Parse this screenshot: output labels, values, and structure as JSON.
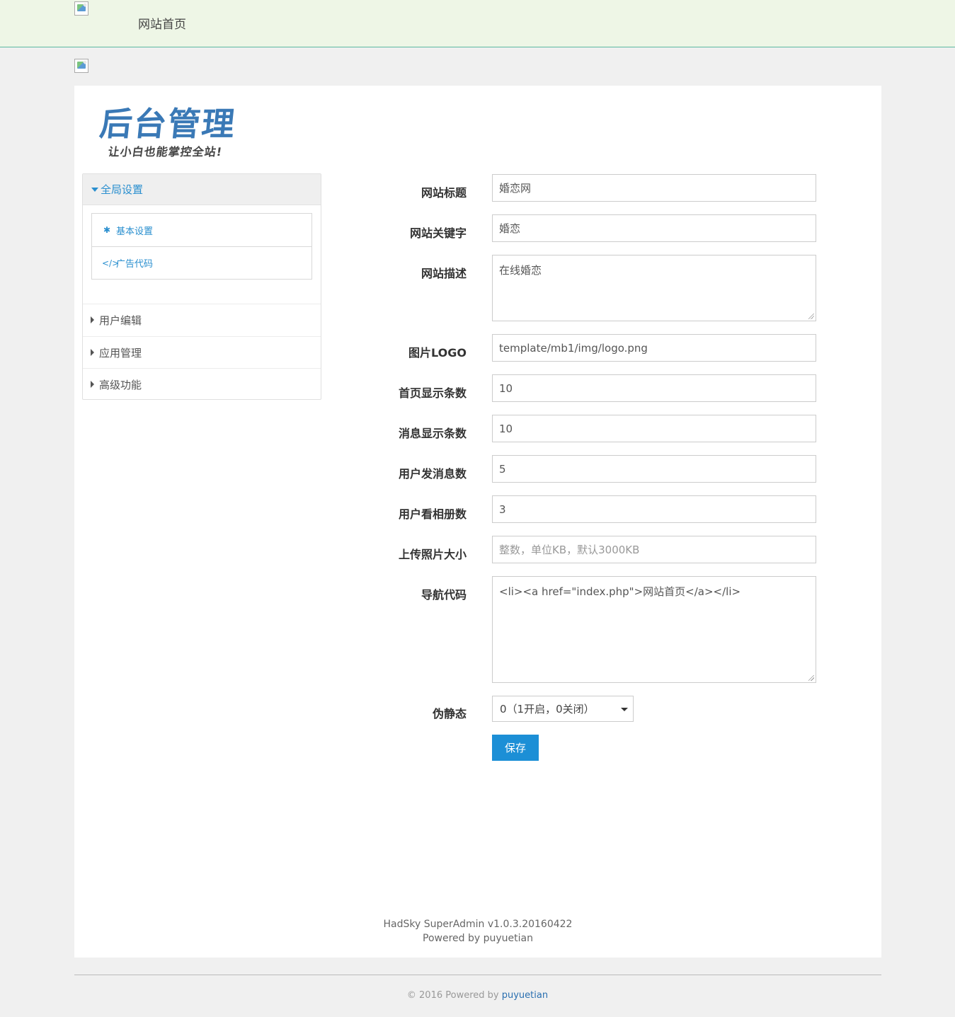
{
  "header": {
    "nav_home": "网站首页"
  },
  "brand": {
    "title": "后台管理",
    "subtitle": "让小白也能掌控全站!"
  },
  "sidebar": {
    "group": {
      "label": "全局设置",
      "items": [
        {
          "label": "基本设置",
          "icon": "gear-icon"
        },
        {
          "label": "广告代码",
          "icon": "code-icon"
        }
      ]
    },
    "items": [
      {
        "label": "用户编辑"
      },
      {
        "label": "应用管理"
      },
      {
        "label": "高级功能"
      }
    ]
  },
  "form": {
    "site_title": {
      "label": "网站标题",
      "value": "婚恋网"
    },
    "site_keywords": {
      "label": "网站关键字",
      "value": "婚恋"
    },
    "site_description": {
      "label": "网站描述",
      "value": "在线婚恋"
    },
    "logo": {
      "label": "图片LOGO",
      "value": "template/mb1/img/logo.png"
    },
    "home_count": {
      "label": "首页显示条数",
      "value": "10"
    },
    "message_count": {
      "label": "消息显示条数",
      "value": "10"
    },
    "user_messages": {
      "label": "用户发消息数",
      "value": "5"
    },
    "user_albums": {
      "label": "用户看相册数",
      "value": "3"
    },
    "upload_size": {
      "label": "上传照片大小",
      "value": "",
      "placeholder": "整数，单位KB，默认3000KB"
    },
    "nav_code": {
      "label": "导航代码",
      "value": "<li><a href=\"index.php\">网站首页</a></li>"
    },
    "rewrite": {
      "label": "伪静态",
      "value": "0（1开启，0关闭）"
    },
    "save_label": "保存"
  },
  "main_footer": {
    "version": "HadSky SuperAdmin v1.0.3.20160422",
    "powered": "Powered by puyuetian"
  },
  "page_footer": {
    "prefix": "© 2016 Powered by",
    "link": "puyuetian"
  },
  "colors": {
    "accent": "#1c8fd6",
    "link": "#2a8fcf",
    "topbar_bg": "#eef6e6",
    "brand": "#3a79b6"
  }
}
